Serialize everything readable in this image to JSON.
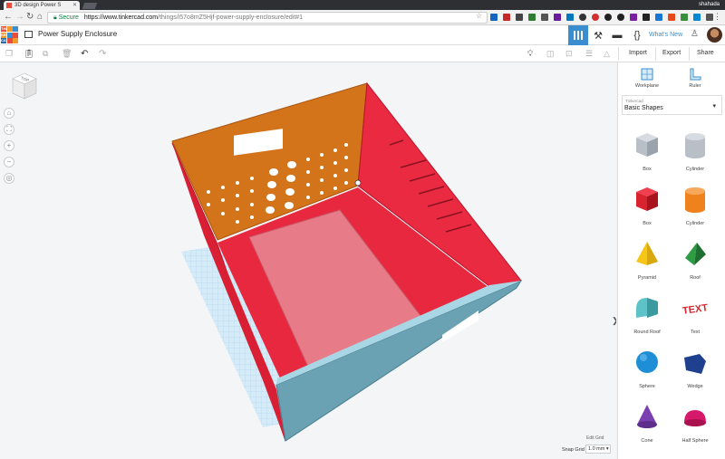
{
  "browser": {
    "tab_title": "3D design Power S",
    "user_name": "shahada",
    "secure_label": "Secure",
    "url_host": "https://www.tinkercad.com",
    "url_path": "/things/i57o8mZ5Hjf-power-supply-enclosure/edit#1"
  },
  "header": {
    "logo_letters": [
      "TIN",
      "KER",
      "CAD"
    ],
    "design_title": "Power Supply Enclosure",
    "whats_new_label": "What's New"
  },
  "toolbar": {
    "import_label": "Import",
    "export_label": "Export",
    "share_label": "Share"
  },
  "canvas": {
    "viewcube_label": "TOP",
    "edit_grid_label": "Edit Grid",
    "snap_grid_label": "Snap Grid",
    "snap_grid_value": "1.0 mm ▾"
  },
  "panel": {
    "workplane_label": "Workplane",
    "ruler_label": "Ruler",
    "library_small_label": "Tinkercad",
    "library_value": "Basic Shapes",
    "shapes": [
      {
        "label": "Box",
        "icon": "box-hole-icon",
        "color": "#b8bfc7"
      },
      {
        "label": "Cylinder",
        "icon": "cylinder-hole-icon",
        "color": "#b8bfc7"
      },
      {
        "label": "Box",
        "icon": "box-icon",
        "color": "#d9232e"
      },
      {
        "label": "Cylinder",
        "icon": "cylinder-icon",
        "color": "#f0821e"
      },
      {
        "label": "Pyramid",
        "icon": "pyramid-icon",
        "color": "#f5c518"
      },
      {
        "label": "Roof",
        "icon": "roof-icon",
        "color": "#2e9b45"
      },
      {
        "label": "Round Roof",
        "icon": "round-roof-icon",
        "color": "#5ec3c9"
      },
      {
        "label": "Text",
        "icon": "text-icon",
        "color": "#d9232e"
      },
      {
        "label": "Sphere",
        "icon": "sphere-icon",
        "color": "#1e8fd6"
      },
      {
        "label": "Wedge",
        "icon": "wedge-icon",
        "color": "#1f3f8f"
      },
      {
        "label": "Cone",
        "icon": "cone-icon",
        "color": "#7a3fb0"
      },
      {
        "label": "Half Sphere",
        "icon": "half-sphere-icon",
        "color": "#d6196b"
      }
    ]
  },
  "colors": {
    "accent": "#3a8ecf",
    "model_red": "#e21f37",
    "model_orange": "#d3741a",
    "model_blue": "#6aa1b3"
  }
}
